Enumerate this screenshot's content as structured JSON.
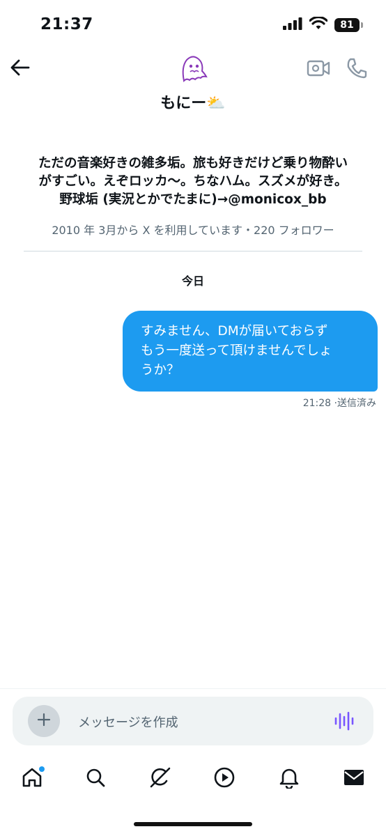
{
  "status_bar": {
    "time": "21:37",
    "battery": "81"
  },
  "header": {
    "display_name": "もにー⛅"
  },
  "profile": {
    "bio_lines": [
      "ただの音楽好きの雑多垢。旅も好きだけど乗り物酔い",
      "がすごい。えぞロッカ〜。ちなハム。スズメが好き。",
      "野球垢 (実況とかでたまに)→@monicox_bb"
    ],
    "meta": "2010 年 3月から X を利用しています・220 フォロワー"
  },
  "conversation": {
    "day_label": "今日",
    "messages": [
      {
        "lines": [
          "すみません、DMが届いておらず",
          "もう一度送って頂けませんでしょ",
          "うか？"
        ],
        "time": "21:28",
        "status": "·送信済み"
      }
    ]
  },
  "composer": {
    "placeholder": "メッセージを作成"
  },
  "icons": {
    "back": "arrow-left-icon",
    "avatar": "ghost-avatar",
    "video": "video-call-icon",
    "call": "phone-icon",
    "plus": "plus-icon",
    "voice": "waveform-icon",
    "tabs": [
      "home-icon",
      "search-icon",
      "grok-icon",
      "play-icon",
      "bell-icon",
      "mail-icon"
    ]
  },
  "colors": {
    "accent": "#1d9bf0",
    "voice": "#7856ff",
    "secondary_text": "#536471",
    "avatar_stroke": "#8a3ab9"
  }
}
